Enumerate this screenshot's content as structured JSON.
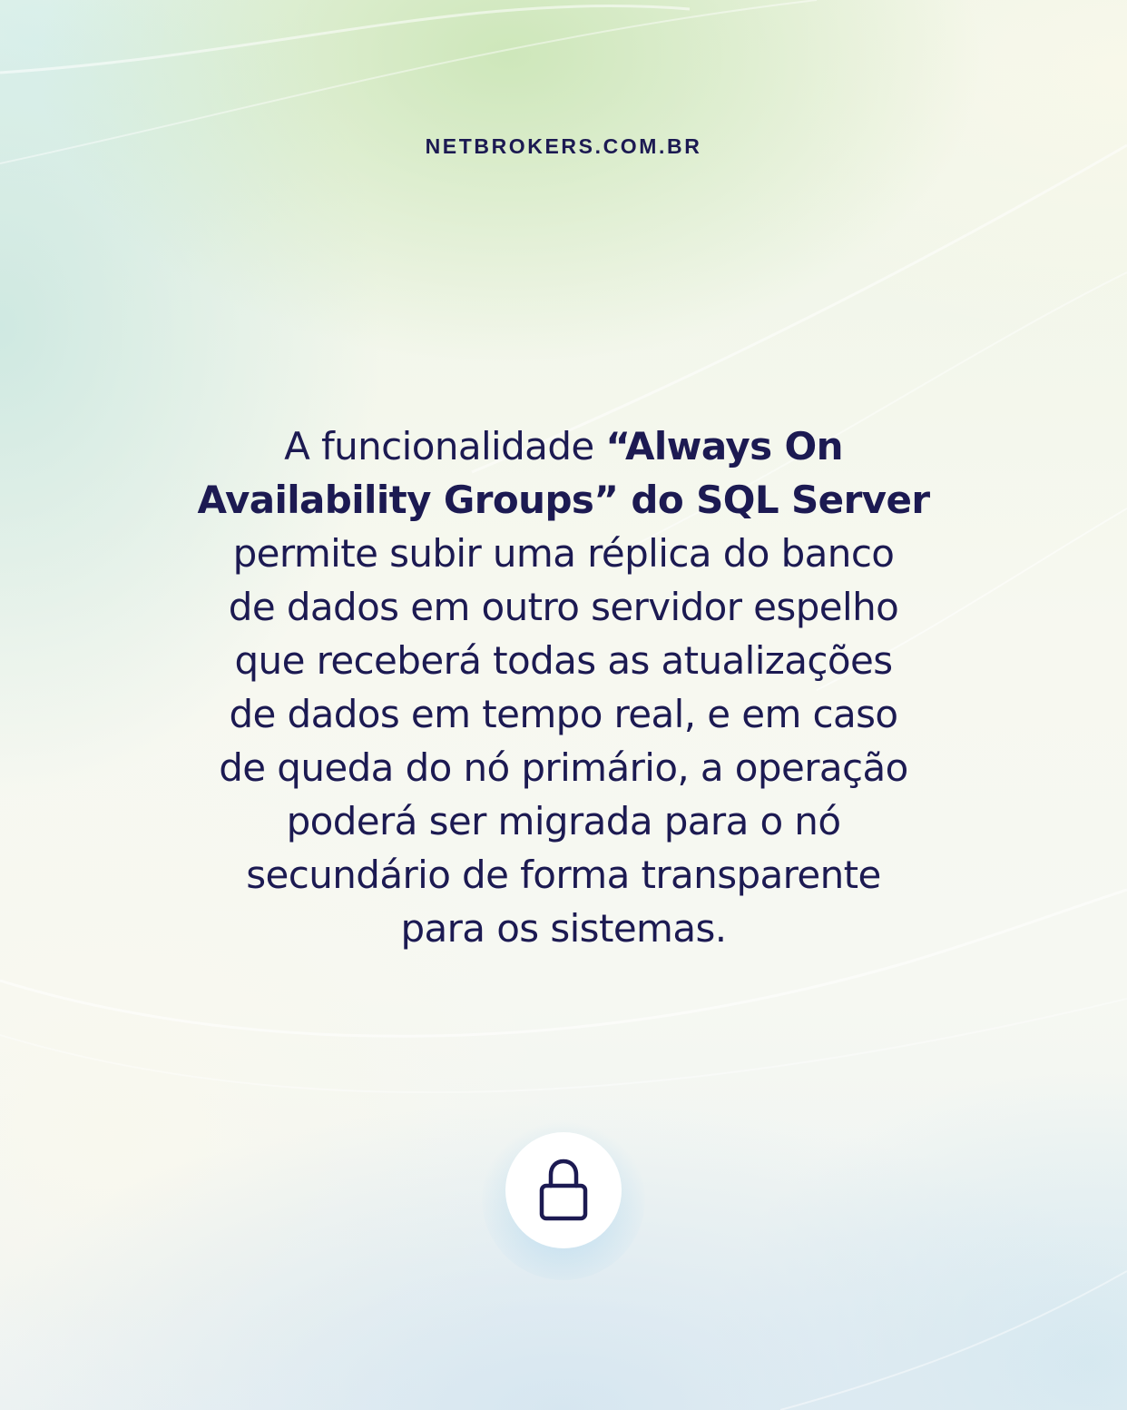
{
  "header": {
    "site_url": "NETBROKERS.COM.BR"
  },
  "content": {
    "line_1_regular": "A funcionalidade ",
    "line_1_bold": "“Always On",
    "line_2_bold": "Availability Groups” do SQL Server",
    "line_3": "permite subir uma réplica do banco",
    "line_4": "de dados em outro servidor espelho",
    "line_5": "que receberá todas as atualizações",
    "line_6": "de dados em tempo real, e em caso",
    "line_7": "de queda do nó primário, a operação",
    "line_8": "poderá ser migrada para o nó",
    "line_9": "secundário de forma transparente",
    "line_10": "para os sistemas."
  },
  "icons": {
    "bottom_icon": "lock-icon"
  },
  "colors": {
    "text": "#1c1a52",
    "icon_background": "#ffffff"
  }
}
